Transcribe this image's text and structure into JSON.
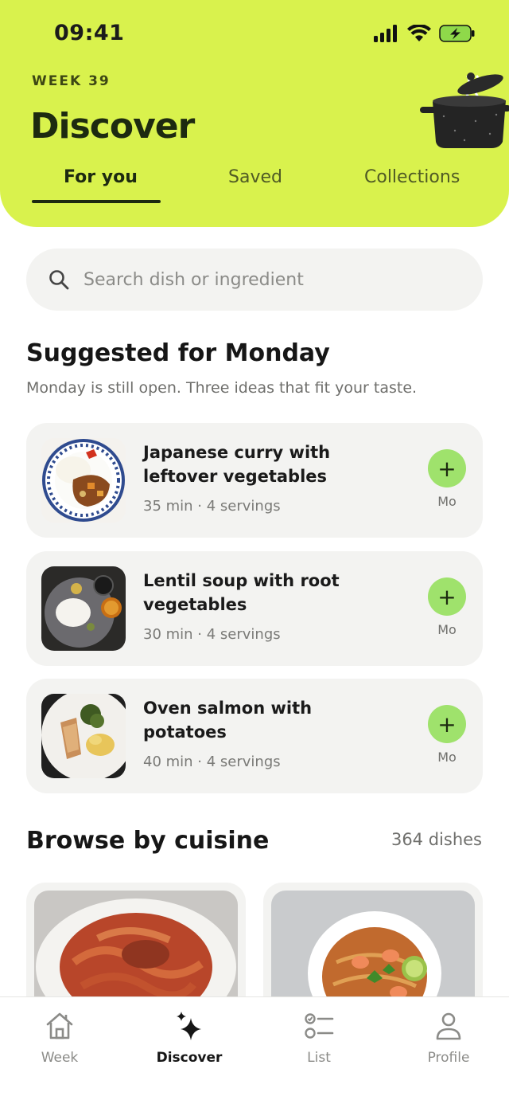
{
  "status": {
    "time": "09:41"
  },
  "header": {
    "week": "WEEK 39",
    "title": "Discover",
    "tabs": [
      {
        "label": "For you",
        "active": true
      },
      {
        "label": "Saved",
        "active": false
      },
      {
        "label": "Collections",
        "active": false
      }
    ]
  },
  "search": {
    "placeholder": "Search dish or ingredient"
  },
  "suggested": {
    "title": "Suggested for Monday",
    "subtitle": "Monday is still open. Three ideas that fit your taste.",
    "items": [
      {
        "name": "Japanese curry with leftover vegetables",
        "meta": "35 min · 4 servings",
        "add": "+",
        "day": "Mo"
      },
      {
        "name": "Lentil soup with root vegetables",
        "meta": "30 min · 4 servings",
        "add": "+",
        "day": "Mo"
      },
      {
        "name": "Oven salmon with potatoes",
        "meta": "40 min · 4 servings",
        "add": "+",
        "day": "Mo"
      }
    ]
  },
  "browse": {
    "title": "Browse by cuisine",
    "count": "364 dishes"
  },
  "nav": {
    "items": [
      {
        "label": "Week",
        "icon": "home-icon"
      },
      {
        "label": "Discover",
        "icon": "sparkle-icon",
        "active": true
      },
      {
        "label": "List",
        "icon": "checklist-icon"
      },
      {
        "label": "Profile",
        "icon": "person-icon"
      }
    ]
  },
  "colors": {
    "accent": "#d9f24d",
    "add_button": "#9fe26c",
    "card": "#f3f3f1"
  }
}
